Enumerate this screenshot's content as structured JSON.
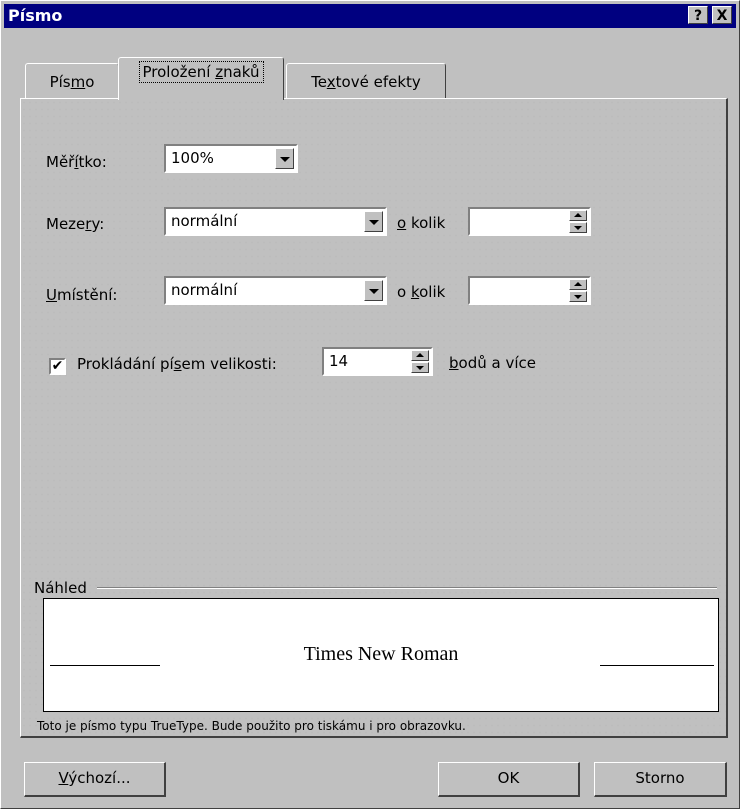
{
  "window": {
    "title": "Písmo",
    "help_label": "?",
    "close_label": "X"
  },
  "tabs": [
    {
      "label_pre": "Pís",
      "label_u": "m",
      "label_post": "o"
    },
    {
      "label_pre": "Proložení ",
      "label_u": "z",
      "label_post": "naků"
    },
    {
      "label_pre": "Te",
      "label_u": "x",
      "label_post": "tové efekty"
    }
  ],
  "scale": {
    "label_pre": "Měř",
    "label_u": "í",
    "label_post": "tko:",
    "value": "100%"
  },
  "spacing": {
    "label_pre": "Meze",
    "label_u": "r",
    "label_post": "y:",
    "value": "normální",
    "by_u": "o",
    "by_post": " kolik",
    "by_value": ""
  },
  "position": {
    "label_u": "U",
    "label_post": "místění:",
    "value": "normální",
    "by_pre": "o ",
    "by_u": "k",
    "by_post": "olik",
    "by_value": ""
  },
  "kerning": {
    "checked": true,
    "check_mark": "✔",
    "label_pre": "Prokládání pí",
    "label_u": "s",
    "label_post": "em velikosti:",
    "value": "14",
    "suffix_u": "b",
    "suffix_post": "odů a více"
  },
  "preview": {
    "group_label": "Náhled",
    "sample_text": "Times New Roman",
    "note": "Toto je písmo typu TrueType. Bude použito pro tiskámu i pro obrazovku."
  },
  "buttons": {
    "default_u": "V",
    "default_post": "ýchozí...",
    "ok": "OK",
    "cancel": "Storno"
  }
}
